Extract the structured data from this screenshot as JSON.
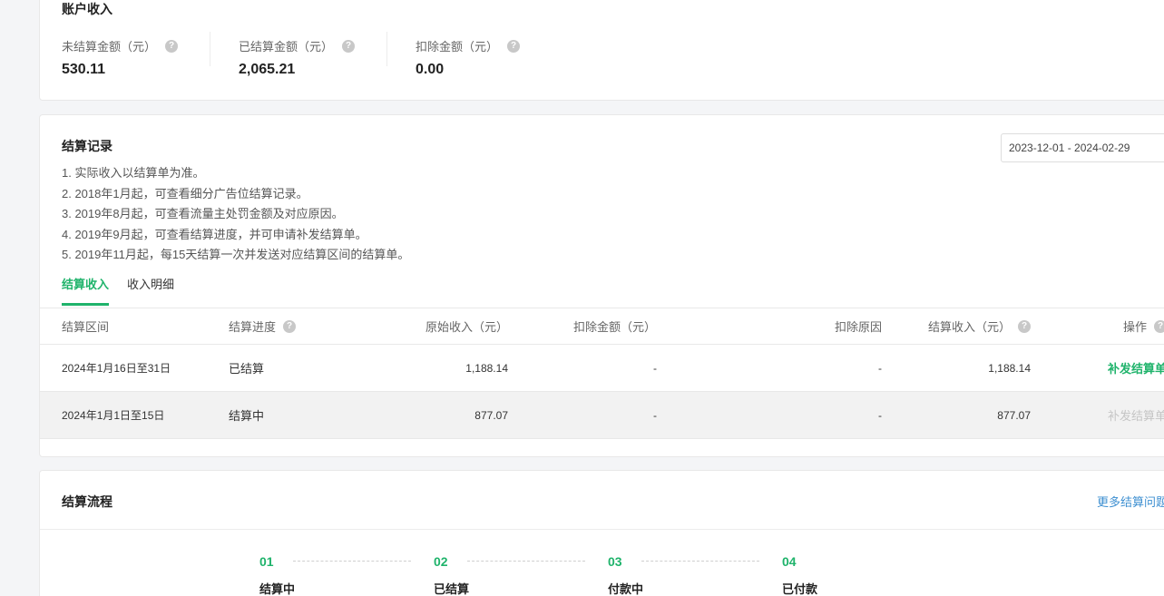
{
  "income": {
    "title": "账户收入",
    "stats": [
      {
        "label": "未结算金额（元）",
        "value": "530.11"
      },
      {
        "label": "已结算金额（元）",
        "value": "2,065.21"
      },
      {
        "label": "扣除金额（元）",
        "value": "0.00"
      }
    ]
  },
  "records": {
    "title": "结算记录",
    "date_range": "2023-12-01 - 2024-02-29",
    "notes": [
      "1. 实际收入以结算单为准。",
      "2. 2018年1月起，可查看细分广告位结算记录。",
      "3. 2019年8月起，可查看流量主处罚金额及对应原因。",
      "4. 2019年9月起，可查看结算进度，并可申请补发结算单。",
      "5. 2019年11月起，每15天结算一次并发送对应结算区间的结算单。"
    ],
    "tabs": [
      {
        "label": "结算收入",
        "active": true
      },
      {
        "label": "收入明细",
        "active": false
      }
    ],
    "columns": {
      "period": "结算区间",
      "progress": "结算进度",
      "original": "原始收入（元）",
      "deduction": "扣除金额（元）",
      "reason": "扣除原因",
      "settled": "结算收入（元）",
      "action": "操作"
    },
    "rows": [
      {
        "period": "2024年1月16日至31日",
        "progress": "已结算",
        "original": "1,188.14",
        "deduction": "-",
        "reason": "-",
        "settled": "1,188.14",
        "action": "补发结算单",
        "action_enabled": true
      },
      {
        "period": "2024年1月1日至15日",
        "progress": "结算中",
        "original": "877.07",
        "deduction": "-",
        "reason": "-",
        "settled": "877.07",
        "action": "补发结算单",
        "action_enabled": false
      }
    ]
  },
  "flow": {
    "title": "结算流程",
    "more_link": "更多结算问题",
    "steps": [
      {
        "num": "01",
        "label": "结算中"
      },
      {
        "num": "02",
        "label": "已结算"
      },
      {
        "num": "03",
        "label": "付款中"
      },
      {
        "num": "04",
        "label": "已付款"
      }
    ]
  },
  "colors": {
    "accent": "#1fb36b",
    "link": "#3d8fd1",
    "disabled": "#c5c5c5"
  },
  "icons": {
    "help": "question-circle-icon"
  }
}
